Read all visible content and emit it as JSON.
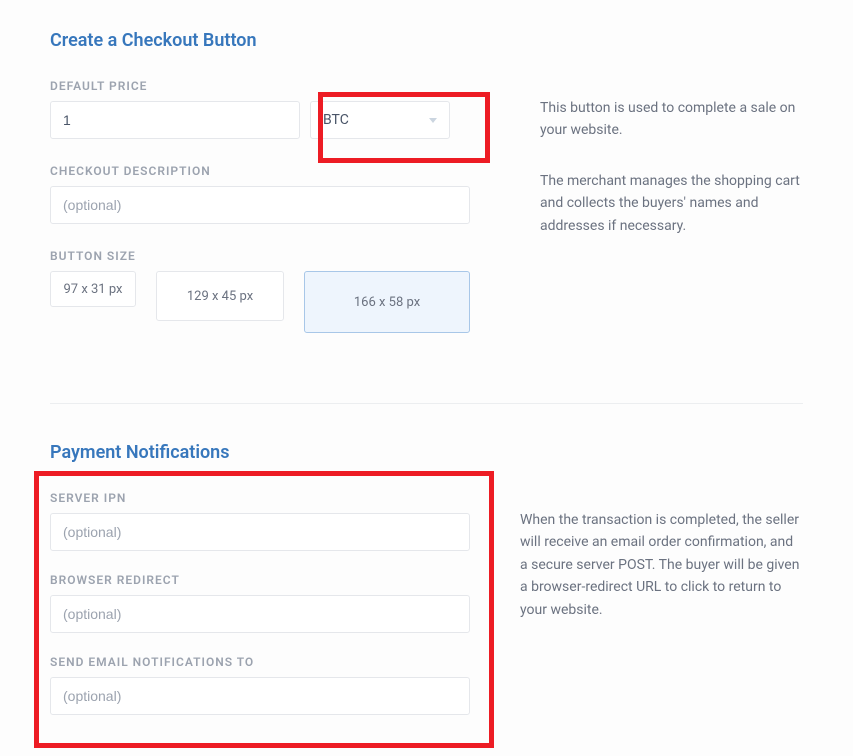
{
  "section1": {
    "title": "Create a Checkout Button",
    "default_price_label": "DEFAULT PRICE",
    "default_price_value": "1",
    "currency_value": "BTC",
    "description_label": "CHECKOUT DESCRIPTION",
    "description_placeholder": "(optional)",
    "button_size_label": "BUTTON SIZE",
    "sizes": {
      "small": "97 x 31 px",
      "medium": "129 x 45 px",
      "large": "166 x 58 px"
    },
    "help1": "This button is used to complete a sale on your website.",
    "help2": "The merchant manages the shopping cart and collects the buyers' names and addresses if necessary."
  },
  "section2": {
    "title": "Payment Notifications",
    "server_ipn_label": "SERVER IPN",
    "server_ipn_placeholder": "(optional)",
    "browser_redirect_label": "BROWSER REDIRECT",
    "browser_redirect_placeholder": "(optional)",
    "email_label": "SEND EMAIL NOTIFICATIONS TO",
    "email_placeholder": "(optional)",
    "help": "When the transaction is completed, the seller will receive an email order confirmation, and a secure server POST. The buyer will be given a browser-redirect URL to click to return to your website."
  }
}
